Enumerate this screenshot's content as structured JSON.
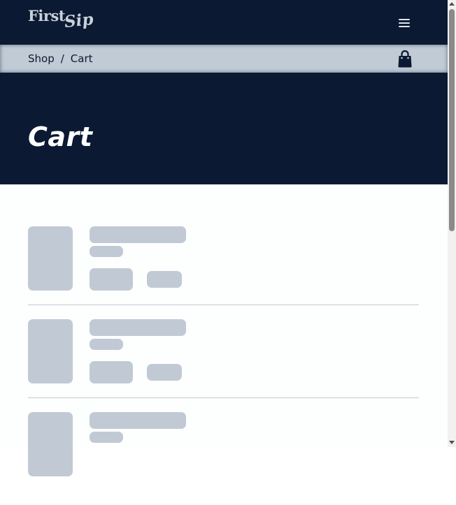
{
  "header": {
    "logo_text_first": "First",
    "logo_text_second": "Sip",
    "menu_icon": "hamburger-menu-icon"
  },
  "breadcrumb": {
    "items": [
      "Shop",
      "Cart"
    ],
    "separator": "/",
    "cart_icon": "shopping-bag-icon"
  },
  "hero": {
    "title": "Cart"
  },
  "cart_items": [
    {
      "state": "loading-skeleton"
    },
    {
      "state": "loading-skeleton"
    },
    {
      "state": "loading-skeleton"
    }
  ],
  "colors": {
    "navy": "#0b1a32",
    "breadcrumb_bg": "#c0cbd5",
    "skeleton": "#c1cad4",
    "content_bg": "#fdfefe",
    "text_light": "#ffffff"
  }
}
